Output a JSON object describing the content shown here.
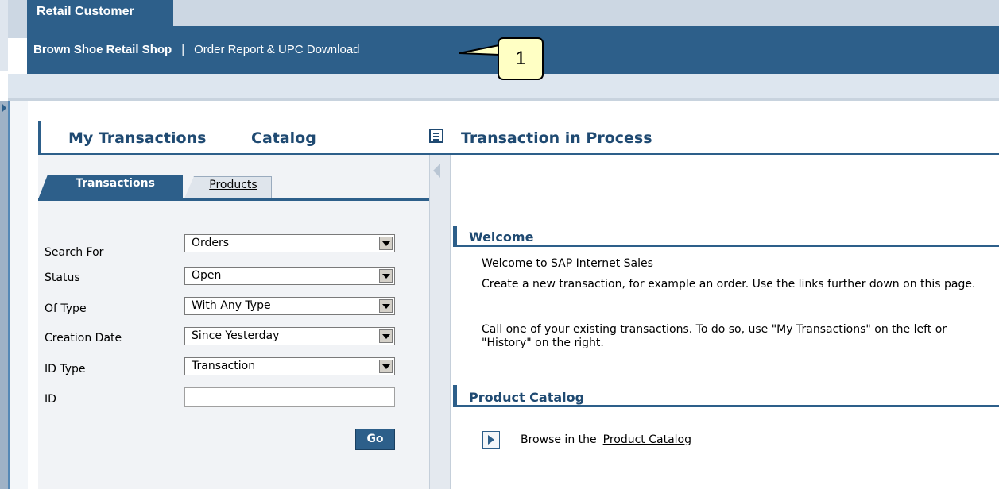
{
  "header": {
    "tab_label": "Retail Customer",
    "shop_name": "Brown Shoe Retail Shop",
    "separator": "|",
    "report_link": "Order Report & UPC Download"
  },
  "callout": {
    "number": "1"
  },
  "nav": {
    "my_transactions": "My Transactions",
    "catalog": "Catalog",
    "transaction_in_process": "Transaction in Process",
    "tx_icon": "document-list-icon"
  },
  "left_panel": {
    "tabs": [
      {
        "label": "Transactions",
        "active": true
      },
      {
        "label": "Products",
        "active": false
      }
    ],
    "fields": [
      {
        "label": "Search For",
        "value": "Orders"
      },
      {
        "label": "Status",
        "value": "Open"
      },
      {
        "label": "Of Type",
        "value": "With Any Type"
      },
      {
        "label": "Creation Date",
        "value": "Since Yesterday"
      },
      {
        "label": "ID Type",
        "value": "Transaction"
      }
    ],
    "id_label": "ID",
    "id_value": "",
    "go_label": "Go"
  },
  "right_panel": {
    "welcome": {
      "title": "Welcome",
      "lines": [
        "Welcome to SAP Internet Sales",
        "Create a new transaction, for example an order. Use the links further down on this page.",
        "Call one of your existing transactions. To do so, use \"My Transactions\" on the left or \"History\" on the right."
      ]
    },
    "catalog": {
      "title": "Product Catalog",
      "browse_text": "Browse in the",
      "browse_link": "Product Catalog"
    }
  },
  "colors": {
    "brand_blue": "#2d5f8a",
    "link_blue": "#1f4a72",
    "callout_yellow": "#ffffc4"
  }
}
